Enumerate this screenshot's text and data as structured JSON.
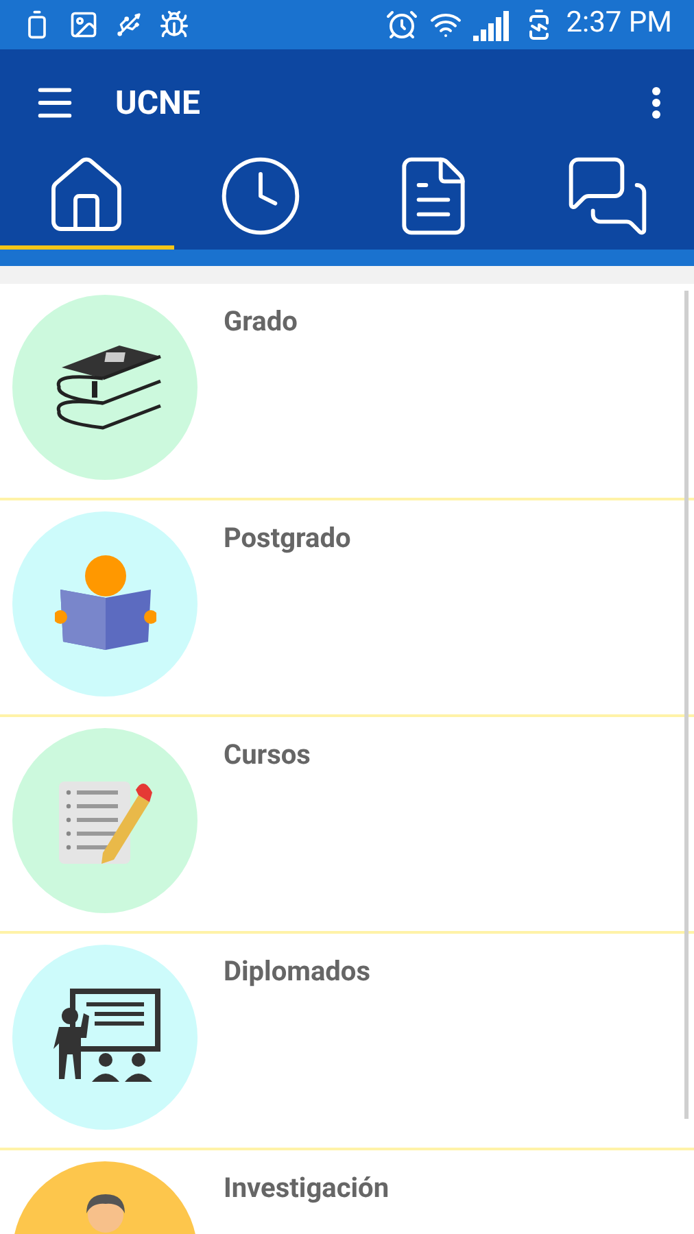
{
  "status_bar": {
    "time": "2:37 PM"
  },
  "toolbar": {
    "title": "UCNE"
  },
  "tabs": [
    {
      "kind": "home",
      "selected": true
    },
    {
      "kind": "clock",
      "selected": false
    },
    {
      "kind": "document",
      "selected": false
    },
    {
      "kind": "chat",
      "selected": false
    }
  ],
  "items": [
    {
      "title": "Grado",
      "kind": "books",
      "color": "#ccf9dd"
    },
    {
      "title": "Postgrado",
      "kind": "reader",
      "color": "#cdfbfb"
    },
    {
      "title": "Cursos",
      "kind": "checklist",
      "color": "#ccf9dd"
    },
    {
      "title": "Diplomados",
      "kind": "teacher",
      "color": "#cdfbfb"
    },
    {
      "title": "Investigación",
      "kind": "researcher",
      "color": "#fdc64c"
    }
  ]
}
